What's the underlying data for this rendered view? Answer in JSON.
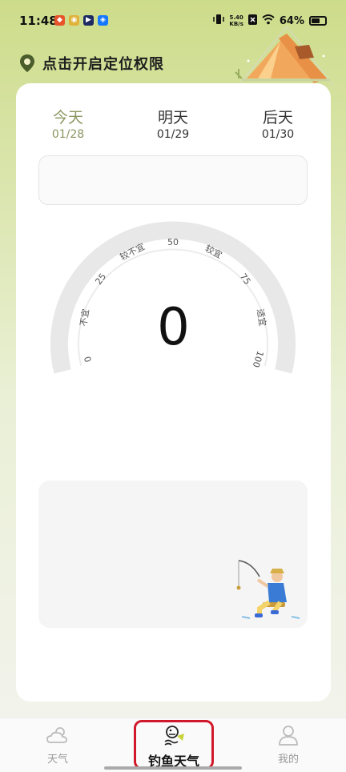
{
  "status_bar": {
    "time": "11:48",
    "speed_value": "5.40",
    "speed_unit": "KB/s",
    "battery": "64%",
    "battery_level": 0.64
  },
  "location": {
    "prompt": "点击开启定位权限"
  },
  "tabs": [
    {
      "label": "今天",
      "date": "01/28"
    },
    {
      "label": "明天",
      "date": "01/29"
    },
    {
      "label": "后天",
      "date": "01/30"
    }
  ],
  "gauge": {
    "score": "0",
    "ticks": [
      "0",
      "25",
      "50",
      "75",
      "100"
    ],
    "grades": [
      "不宜",
      "较不宜",
      "较宜",
      "适宜"
    ]
  },
  "bottom_nav": [
    {
      "label": "天气"
    },
    {
      "label": "钓鱼天气"
    },
    {
      "label": "我的"
    }
  ],
  "colors": {
    "accent": "#8a9560",
    "highlight_border": "#d0192b"
  }
}
